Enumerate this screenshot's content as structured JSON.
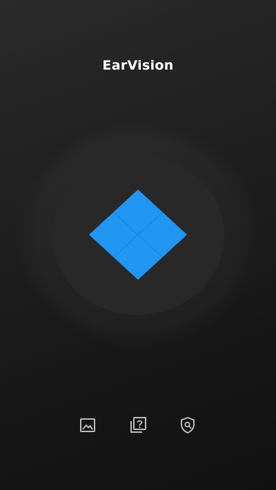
{
  "app": {
    "title": "EarVision"
  },
  "colors": {
    "background": "#1c1c1c",
    "logo_blue": "#2196f3",
    "halo_inner": "#282828",
    "icon_gray": "#bdbdbd"
  },
  "main": {
    "logo_icon": "diamond-grid-logo"
  },
  "bottom_nav": {
    "items": [
      {
        "icon": "image-icon"
      },
      {
        "icon": "help-pages-icon"
      },
      {
        "icon": "shield-search-icon"
      }
    ]
  }
}
